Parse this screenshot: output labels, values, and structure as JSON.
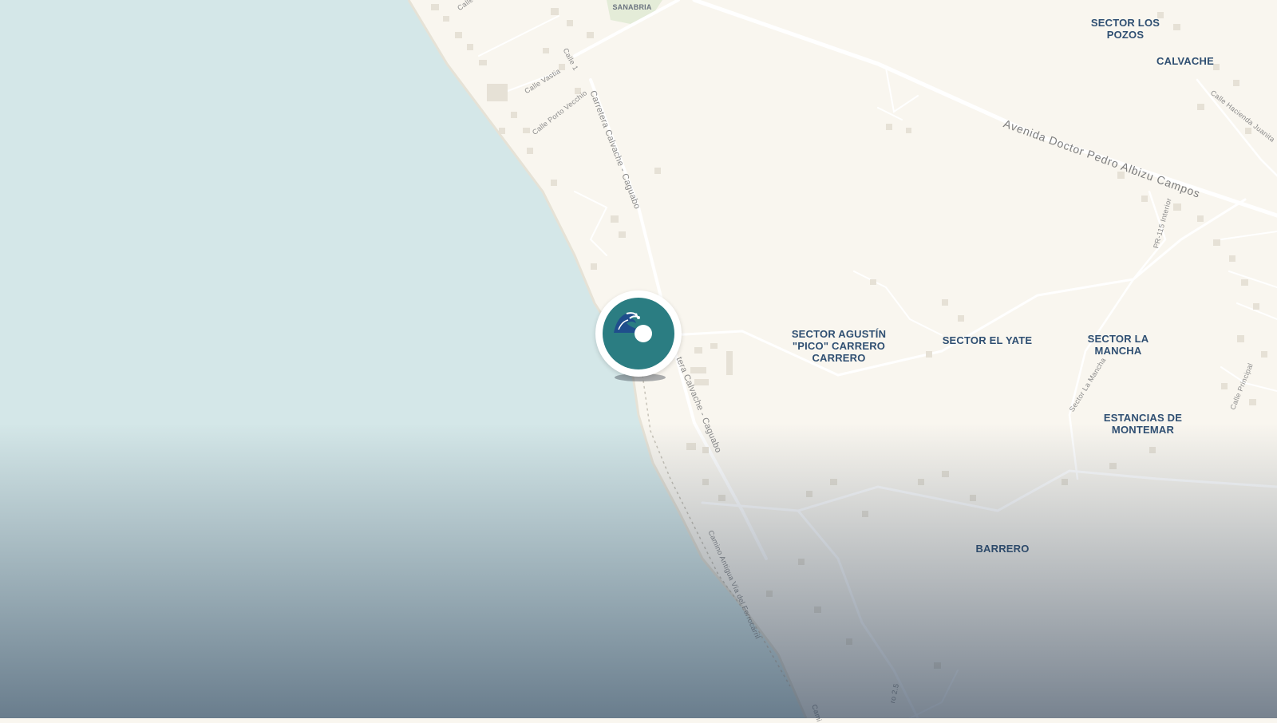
{
  "map": {
    "colors": {
      "water": "#d4e7e8",
      "land": "#f9f6ef",
      "road": "#ffffff",
      "label": "#2f4f72",
      "marker": "#2b7d82"
    },
    "places": [
      {
        "id": "sanabria",
        "label": "SANABRIA"
      },
      {
        "id": "los-pozos",
        "label": "SECTOR LOS\nPOZOS"
      },
      {
        "id": "calvache",
        "label": "CALVACHE"
      },
      {
        "id": "agustin",
        "label": "SECTOR AGUSTÍN\n\"PICO\" CARRERO\nCARRERO"
      },
      {
        "id": "el-yate",
        "label": "SECTOR EL YATE"
      },
      {
        "id": "la-mancha",
        "label": "SECTOR LA\nMANCHA"
      },
      {
        "id": "montemar",
        "label": "ESTANCIAS DE\nMONTEMAR"
      },
      {
        "id": "barrero",
        "label": "BARRERO"
      }
    ],
    "streets": [
      {
        "id": "calle-top",
        "label": "Calle"
      },
      {
        "id": "calle-1",
        "label": "Calle 1"
      },
      {
        "id": "calle-vastia",
        "label": "Calle Vastia"
      },
      {
        "id": "calle-porto",
        "label": "Calle Porto Vecchio"
      },
      {
        "id": "carretera-north",
        "label": "Carretera Calvache - Caguabo"
      },
      {
        "id": "carretera-south",
        "label": "tera Calvache - Caguabo"
      },
      {
        "id": "avenida",
        "label": "Avenida Doctor Pedro Albizu Campos"
      },
      {
        "id": "hacienda",
        "label": "Calle Hacienda Juanita"
      },
      {
        "id": "pr115",
        "label": "PR-115 Interior"
      },
      {
        "id": "la-mancha-road",
        "label": "Sector La Mancha"
      },
      {
        "id": "principal",
        "label": "Calle Principal"
      },
      {
        "id": "ferrocarril",
        "label": "Camino Antigua Vía del Ferrocarril"
      },
      {
        "id": "camino-bottom",
        "label": "Cami"
      },
      {
        "id": "road-25",
        "label": "ro 2.5"
      }
    ],
    "marker": {
      "icon": "wave-icon"
    }
  }
}
